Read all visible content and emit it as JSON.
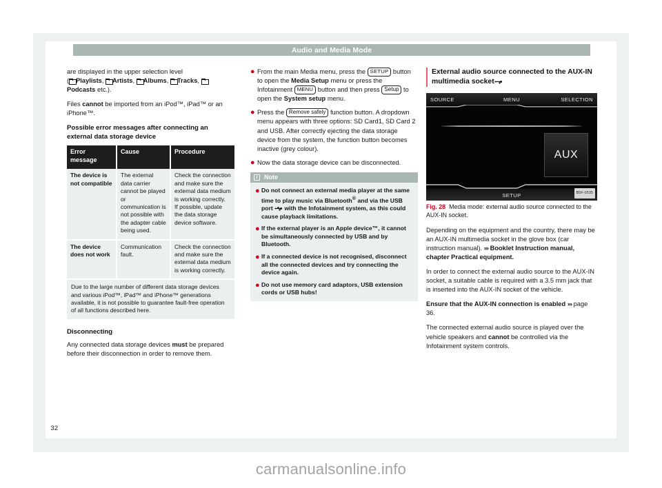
{
  "document": {
    "running_head": "Audio and Media Mode",
    "page_number": "32",
    "watermark": "carmanualsonline.info"
  },
  "column_left": {
    "para_1_prefix": "are displayed in the upper selection level",
    "para_1_line2_open": "(",
    "folder_items": [
      "Playlists",
      "Artists",
      "Albums",
      "Tracks",
      "Podcasts"
    ],
    "para_1_suffix": "etc.).",
    "para_2_a": "Files ",
    "para_2_b": "cannot",
    "para_2_c": " be imported from an iPod™, iPad™ or an iPhone™.",
    "heading": "Possible error messages after connecting an external data storage device",
    "table": {
      "headers": [
        "Error message",
        "Cause",
        "Procedure"
      ],
      "rows": [
        {
          "message": "The device is not compatible",
          "cause": "The external data carrier cannot be played or communication is not possible with the adapter cable being used.",
          "procedure": "Check the connection and make sure the external data medium is working correctly.\nIf possible, update the data storage device software."
        },
        {
          "message": "The device does not work",
          "cause": "Communication fault.",
          "procedure": "Check the connection and make sure the external data medium is working correctly."
        }
      ],
      "footnote": "Due to the large number of different data storage devices and various iPod™, iPad™ and iPhone™ generations available, it is not possible to guarantee fault-free operation of all functions described here."
    },
    "heading_2": "Disconnecting",
    "para_3_a": "Any connected data storage devices ",
    "para_3_b": "must",
    "para_3_c": " be prepared before their disconnection in order to remove them."
  },
  "column_middle": {
    "bullets": [
      {
        "seg_1": "From the main Media menu, press the ",
        "key_1": "SETUP",
        "seg_2": " button to open the ",
        "bold_1": "Media Setup",
        "seg_3": " menu or press the Infotainment ",
        "key_2": "MENU",
        "seg_4": " button and then press ",
        "key_3": "Setup",
        "seg_5": " to open the ",
        "bold_2": "System setup",
        "seg_6": " menu."
      },
      {
        "seg_1": "Press the ",
        "key_1": "Remove safely",
        "seg_2": " function button. A dropdown menu appears with three options: SD Card1, SD Card 2 and USB. After correctly ejecting the data storage device from the system, the function button becomes inactive (grey colour)."
      },
      {
        "seg_1": "Now the data storage device can be disconnected."
      }
    ],
    "note": {
      "title": "Note",
      "icon": "info-icon",
      "items": [
        {
          "part_a": "Do not connect an external media player at the same time to play music via Bluetooth",
          "sup": "®",
          "part_b": " and via the USB port ",
          "icon": "usb-icon",
          "part_c": " with the Infotainment system, as this could cause playback limitations."
        },
        {
          "part_a": "If the external player is an Apple device™, it cannot be simultaneously connected by USB and by Bluetooth."
        },
        {
          "part_a": "If a connected device is not recognised, disconnect all the connected devices and try connecting the device again."
        },
        {
          "part_a": "Do not use memory card adaptors, USB extension cords or USB hubs!"
        }
      ]
    }
  },
  "column_right": {
    "heading_a": "External audio source connected to the AUX-IN multimedia socket",
    "heading_icon": "usb-icon",
    "figure": {
      "screen": {
        "top_left": "SOURCE",
        "top_middle": "MENU",
        "top_right": "SELECTION",
        "bottom_center": "SETUP",
        "aux_tile": "AUX",
        "image_code": "B5F-0535"
      },
      "caption_number": "Fig. 28",
      "caption_text": "Media mode: external audio source connected to the AUX-IN socket."
    },
    "para_1": "Depending on the equipment and the country, there may be an AUX-IN multimedia socket in the glove box (car instruction manual).",
    "para_1_ref_arrows": "›››",
    "para_1_ref": " Booklet Instruction manual, chapter Practical equipment.",
    "para_2": "In order to connect the external audio source to the AUX-IN socket, a suitable cable is required with a 3.5 mm jack that is inserted into the AUX-IN socket of the vehicle.",
    "para_3_bold": "Ensure that the AUX-IN connection is enabled",
    "para_3_arrows": "›››",
    "para_3_page": " page 36.",
    "para_4_a": "The connected external audio source is played over the vehicle speakers and ",
    "para_4_b": "cannot",
    "para_4_c": " be controlled via the Infotainment system controls."
  },
  "colors": {
    "running_head_bg": "#a9b6b4",
    "accent_red": "#d0021b",
    "rule_pink": "#f2566a",
    "table_header_bg": "#1d1d1d",
    "table_cell_bg": "#eceff0",
    "plate_bg": "#eef1f2"
  }
}
